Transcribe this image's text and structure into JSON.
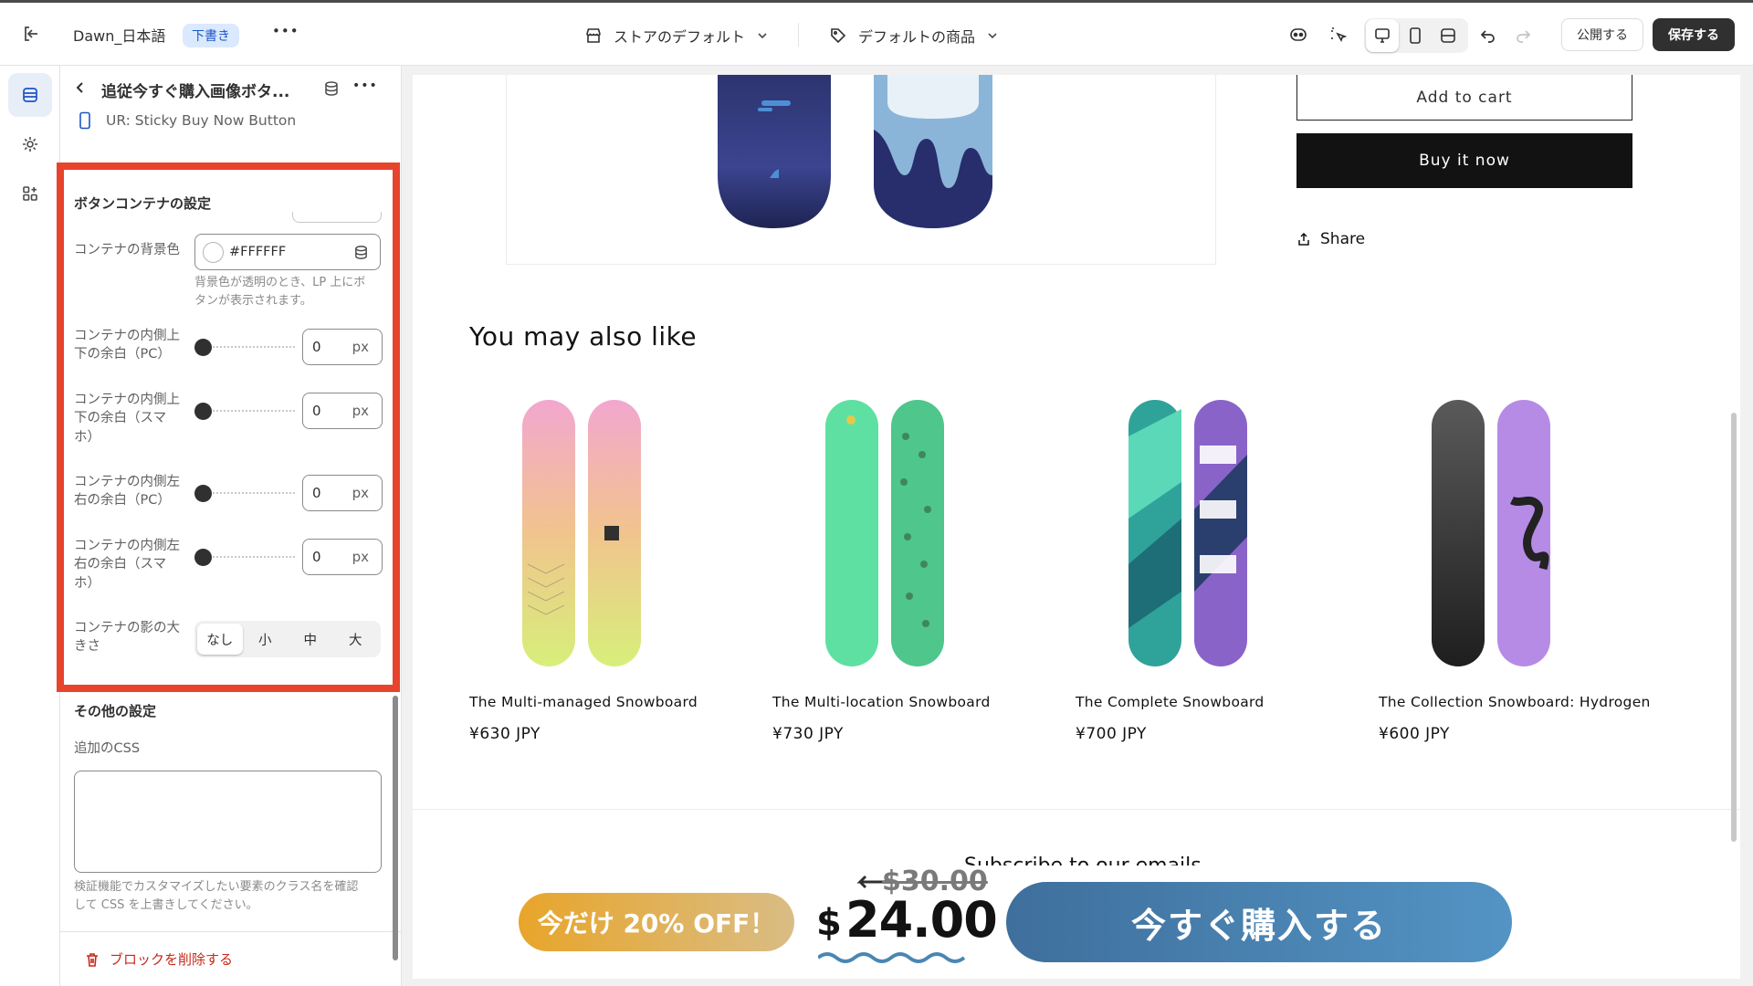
{
  "topbar": {
    "store_name": "Dawn_日本語",
    "status_badge": "下書き",
    "more": "•••",
    "template_label": "ストアのデフォルト",
    "product_label": "デフォルトの商品",
    "publish_label": "公開する",
    "save_label": "保存する"
  },
  "panel": {
    "title": "追従今すぐ購入画像ボタ...",
    "subtitle": "UR: Sticky Buy Now Button",
    "container_section": "ボタンコンテナの設定",
    "bg_label": "コンテナの背景色",
    "bg_value": "#FFFFFF",
    "bg_hint_1": "背景色が透明のとき、LP 上にボ",
    "bg_hint_2": "タンが表示されます。",
    "unit": "px",
    "paddings": [
      {
        "lines": [
          "コンテナの内側上",
          "下の余白（PC）"
        ],
        "value": "0"
      },
      {
        "lines": [
          "コンテナの内側上",
          "下の余白（スマ",
          "ホ）"
        ],
        "value": "0"
      },
      {
        "lines": [
          "コンテナの内側左",
          "右の余白（PC）"
        ],
        "value": "0"
      },
      {
        "lines": [
          "コンテナの内側左",
          "右の余白（スマ",
          "ホ）"
        ],
        "value": "0"
      }
    ],
    "shadow_label_1": "コンテナの影の大",
    "shadow_label_2": "きさ",
    "shadow_options": [
      "なし",
      "小",
      "中",
      "大"
    ],
    "shadow_selected": "なし",
    "other_section": "その他の設定",
    "css_label": "追加のCSS",
    "css_value": "",
    "css_hint_1": "検証機能でカスタマイズしたい要素のクラス名を確認",
    "css_hint_2": "して CSS を上書きしてください。",
    "delete_label": "ブロックを削除する"
  },
  "preview": {
    "add_to_cart": "Add to cart",
    "buy_now": "Buy it now",
    "share": "Share",
    "also_like": "You may also like",
    "products": [
      {
        "name": "The Multi-managed Snowboard",
        "price": "¥630 JPY"
      },
      {
        "name": "The Multi-location Snowboard",
        "price": "¥730 JPY"
      },
      {
        "name": "The Complete Snowboard",
        "price": "¥700 JPY"
      },
      {
        "name": "The Collection Snowboard: Hydrogen",
        "price": "¥600 JPY"
      }
    ],
    "subscribe": "Subscribe to our emails",
    "sticky": {
      "discount": "今だけ 20% OFF！",
      "old_price": "$30.00",
      "currency": "$",
      "new_price": "24.00",
      "buy_button": "今すぐ購入する"
    }
  },
  "colors": {
    "highlight": "#e8432d",
    "sticky_blue": "#4a86b3",
    "sticky_orange": "#e8a52a"
  }
}
